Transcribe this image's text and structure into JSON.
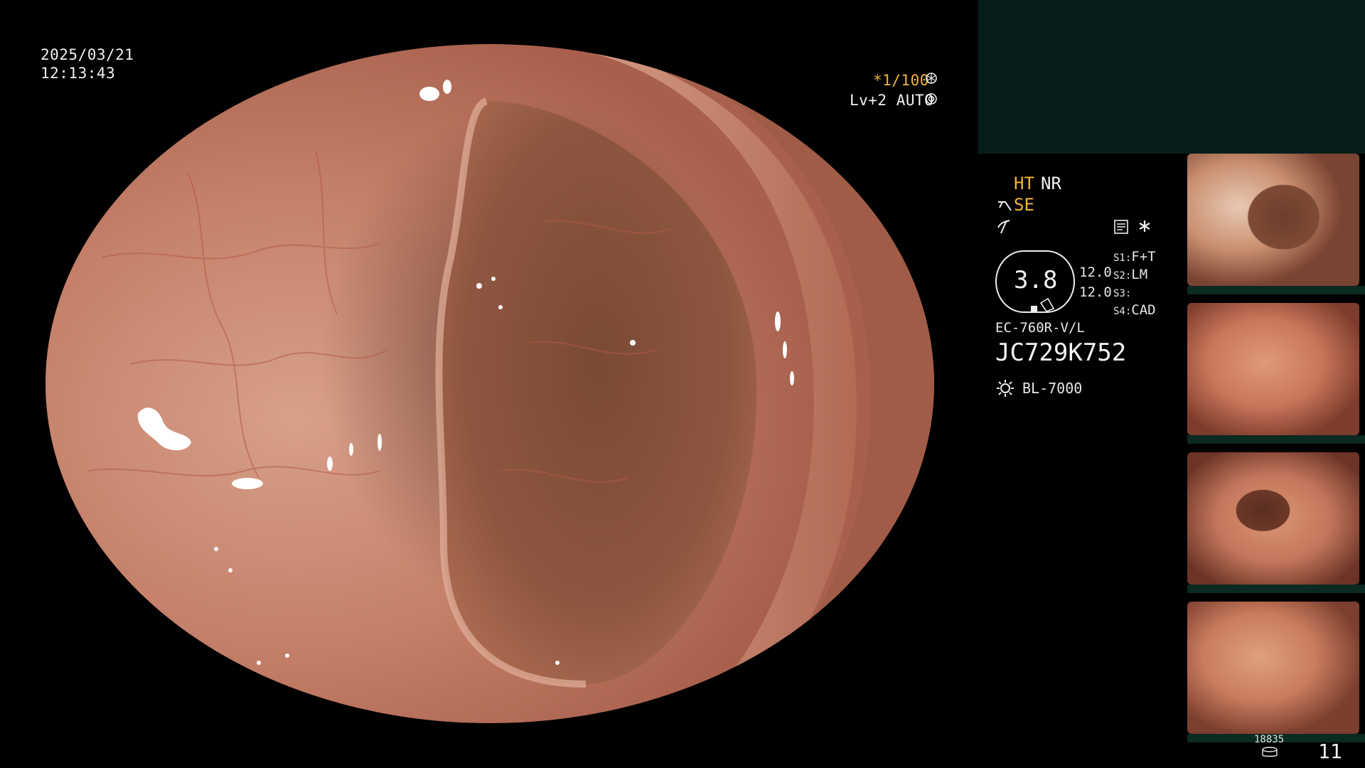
{
  "main_view": {
    "date": "2025/03/21",
    "time": "12:13:43",
    "shutter": "*1/100",
    "brightness": "Lv+2 AUTO"
  },
  "panel": {
    "ht_label": "HT",
    "nr_label": "NR",
    "se_label": "SE",
    "iris_value": "3.8",
    "level_top": "12.0",
    "level_bottom": "12.0",
    "switches": [
      {
        "key": "S1:",
        "value": "F+T"
      },
      {
        "key": "S2:",
        "value": "LM"
      },
      {
        "key": "S3:",
        "value": ""
      },
      {
        "key": "S4:",
        "value": "CAD"
      }
    ],
    "scope_model": "EC-760R-V/L",
    "scope_serial": "JC729K752",
    "light_source": "BL-7000",
    "image_count": "18835",
    "page_number": "11"
  },
  "colors": {
    "accent_yellow": "#f0b43a",
    "status_bar": "#071d1a",
    "mucosa": "#c47f68"
  },
  "icons": {
    "shutter": "aperture-icon",
    "brightness": "dial-icon",
    "scope": "endoscope-icon",
    "air": "air-flow-icon",
    "memo": "memo-icon",
    "asterisk": "asterisk-icon",
    "light": "sun-icon",
    "storage": "storage-icon"
  }
}
